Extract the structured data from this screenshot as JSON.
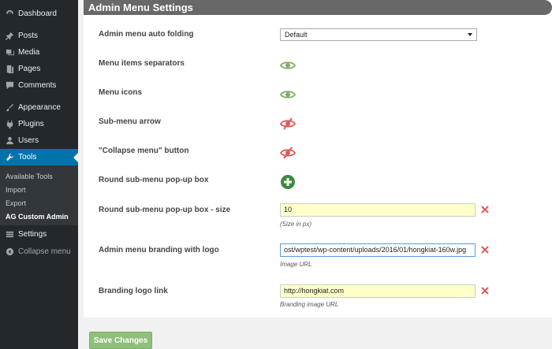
{
  "sidebar": {
    "items": [
      {
        "label": "Dashboard",
        "icon": "dashboard-icon"
      },
      {
        "label": "Posts",
        "icon": "pin-icon"
      },
      {
        "label": "Media",
        "icon": "media-icon"
      },
      {
        "label": "Pages",
        "icon": "page-icon"
      },
      {
        "label": "Comments",
        "icon": "comment-icon"
      },
      {
        "label": "Appearance",
        "icon": "brush-icon"
      },
      {
        "label": "Plugins",
        "icon": "plug-icon"
      },
      {
        "label": "Users",
        "icon": "user-icon"
      },
      {
        "label": "Tools",
        "icon": "wrench-icon",
        "active": true
      },
      {
        "label": "Settings",
        "icon": "settings-icon"
      }
    ],
    "submenu": [
      "Available Tools",
      "Import",
      "Export",
      "AG Custom Admin"
    ],
    "collapse_label": "Collapse menu"
  },
  "panel": {
    "title": "Admin Menu Settings",
    "rows": {
      "auto_folding": {
        "label": "Admin menu auto folding",
        "value": "Default"
      },
      "separators": {
        "label": "Menu items separators",
        "state": "visible"
      },
      "icons": {
        "label": "Menu icons",
        "state": "visible"
      },
      "submenu_arrow": {
        "label": "Sub-menu arrow",
        "state": "hidden"
      },
      "collapse_button": {
        "label": "\"Collapse menu\" button",
        "state": "hidden"
      },
      "round_popup": {
        "label": "Round sub-menu pop-up box",
        "state": "add"
      },
      "round_popup_size": {
        "label": "Round sub-menu pop-up box - size",
        "value": "10",
        "hint": "(Size in px)"
      },
      "branding_logo": {
        "label": "Admin menu branding with logo",
        "value": "ost/wptest/wp-content/uploads/2016/01/hongkiat-160w.jpg",
        "hint": "Image URL"
      },
      "branding_link": {
        "label": "Branding logo link",
        "value": "http://hongkiat.com",
        "hint": "Branding image URL"
      }
    }
  },
  "save_label": "Save Changes",
  "colors": {
    "sidebar": "#23282d",
    "active": "#0073aa",
    "eye_on": "#7fae6a",
    "eye_off": "#e05a5a",
    "input_bg": "#ffffc8"
  }
}
